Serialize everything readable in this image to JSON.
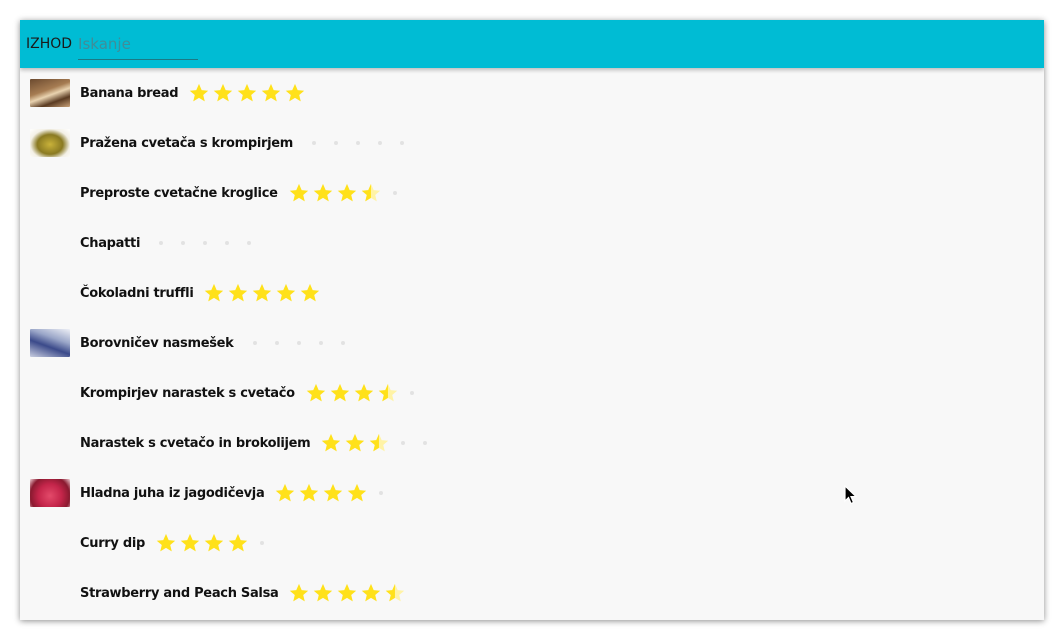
{
  "topbar": {
    "exit_label": "IZHOD",
    "search_placeholder": "Iskanje",
    "background": "#00bcd4"
  },
  "star_color": "#ffe11a",
  "recipes": [
    {
      "name": "Banana bread",
      "rating": 5,
      "thumbnail": "banana-bread-photo"
    },
    {
      "name": "Pražena cvetača s krompirjem",
      "rating": 0,
      "thumbnail": "cauliflower-potato-photo"
    },
    {
      "name": "Preproste cvetačne kroglice",
      "rating": 3.5,
      "thumbnail": null
    },
    {
      "name": "Chapatti",
      "rating": 0,
      "thumbnail": null
    },
    {
      "name": "Čokoladni truffli",
      "rating": 5,
      "thumbnail": null
    },
    {
      "name": "Borovničev nasmešek",
      "rating": 0,
      "thumbnail": "blueberry-smile-photo"
    },
    {
      "name": "Krompirjev narastek s cvetačo",
      "rating": 3.5,
      "thumbnail": null
    },
    {
      "name": "Narastek s cvetačo in brokolijem",
      "rating": 2.5,
      "thumbnail": null
    },
    {
      "name": "Hladna juha iz jagodičevja",
      "rating": 4,
      "thumbnail": "berry-soup-photo"
    },
    {
      "name": "Curry dip",
      "rating": 4,
      "thumbnail": null
    },
    {
      "name": "Strawberry and Peach Salsa",
      "rating": 4.5,
      "thumbnail": null
    }
  ]
}
